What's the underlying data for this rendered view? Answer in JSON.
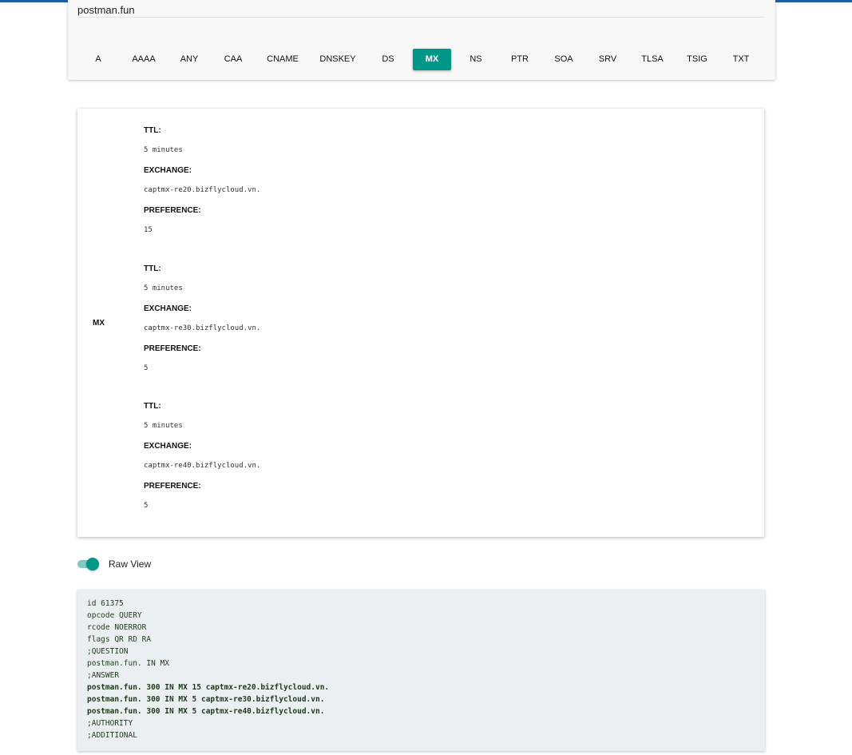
{
  "search": {
    "domain_value": "postman.fun"
  },
  "record_types": [
    "A",
    "AAAA",
    "ANY",
    "CAA",
    "CNAME",
    "DNSKEY",
    "DS",
    "MX",
    "NS",
    "PTR",
    "SOA",
    "SRV",
    "TLSA",
    "TSIG",
    "TXT"
  ],
  "active_type": "MX",
  "result": {
    "type_label": "MX",
    "records": [
      {
        "ttl_label": "TTL:",
        "ttl_value": "5 minutes",
        "exchange_label": "EXCHANGE:",
        "exchange_value": "captmx-re20.bizflycloud.vn.",
        "preference_label": "PREFERENCE:",
        "preference_value": "15"
      },
      {
        "ttl_label": "TTL:",
        "ttl_value": "5 minutes",
        "exchange_label": "EXCHANGE:",
        "exchange_value": "captmx-re30.bizflycloud.vn.",
        "preference_label": "PREFERENCE:",
        "preference_value": "5"
      },
      {
        "ttl_label": "TTL:",
        "ttl_value": "5 minutes",
        "exchange_label": "EXCHANGE:",
        "exchange_value": "captmx-re40.bizflycloud.vn.",
        "preference_label": "PREFERENCE:",
        "preference_value": "5"
      }
    ]
  },
  "raw_view": {
    "toggle_label": "Raw View",
    "enabled": true,
    "lines": [
      "id 61375",
      "opcode QUERY",
      "rcode NOERROR",
      "flags QR RD RA",
      ";QUESTION",
      "postman.fun. IN MX",
      ";ANSWER",
      "postman.fun. 300 IN MX 15 captmx-re20.bizflycloud.vn.",
      "postman.fun. 300 IN MX 5 captmx-re30.bizflycloud.vn.",
      "postman.fun. 300 IN MX 5 captmx-re40.bizflycloud.vn.",
      ";AUTHORITY",
      ";ADDITIONAL"
    ],
    "bold_lines": [
      7,
      8,
      9
    ]
  },
  "colors": {
    "accent": "#009688",
    "accent_light": "#7fcbc4",
    "top_bar": "#1e5fa6",
    "raw_background": "#eceff1"
  }
}
